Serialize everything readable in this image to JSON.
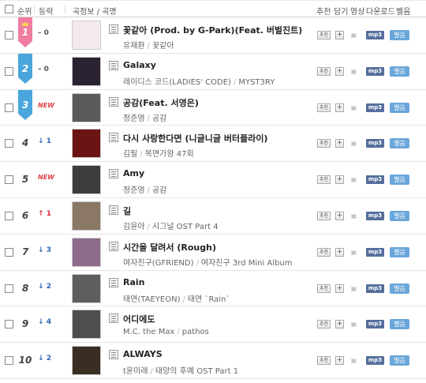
{
  "header": {
    "rank": "순위",
    "change": "등락",
    "song": "곡정보 / 곡명",
    "recommend": "추천",
    "add": "담기",
    "video": "영상",
    "download": "다운로드",
    "bell": "벨음"
  },
  "buttons": {
    "recommend": "추천",
    "add": "+",
    "mp3": "mp3",
    "bell": "벨음"
  },
  "colors": {
    "ribbon_pink": "#f07ca0",
    "ribbon_blue": "#4aa6dc",
    "up": "#d8293a",
    "down": "#2c65b2",
    "mp3": "#556f9c",
    "bell": "#69a6d9"
  },
  "rows": [
    {
      "rank": "1",
      "ribbon": "pink",
      "change": "0",
      "change_type": "same",
      "title": "꽃같아 (Prod. by G-Park)(Feat. 버벌진트)",
      "artist": "유재환",
      "album": "꽃같아",
      "cover": "#f3e9ee"
    },
    {
      "rank": "2",
      "ribbon": "blue",
      "change": "0",
      "change_type": "same",
      "title": "Galaxy",
      "artist": "레이디스 코드(LADIES' CODE)",
      "album": "MYST3RY",
      "cover": "#2a2230"
    },
    {
      "rank": "3",
      "ribbon": "blue",
      "change": "NEW",
      "change_type": "new",
      "title": "공감(Feat. 서영은)",
      "artist": "정준영",
      "album": "공감",
      "cover": "#5a5a5a"
    },
    {
      "rank": "4",
      "ribbon": "",
      "change": "1",
      "change_type": "down",
      "title": "다시 사랑한다면 (니글니글 버터플라이)",
      "artist": "김필",
      "album": "복면가왕 47회",
      "cover": "#6b1414"
    },
    {
      "rank": "5",
      "ribbon": "",
      "change": "NEW",
      "change_type": "new",
      "title": "Amy",
      "artist": "정준영",
      "album": "공감",
      "cover": "#3c3c3c"
    },
    {
      "rank": "6",
      "ribbon": "",
      "change": "1",
      "change_type": "up",
      "title": "길",
      "artist": "김윤아",
      "album": "시그널 OST Part 4",
      "cover": "#8a7766"
    },
    {
      "rank": "7",
      "ribbon": "",
      "change": "3",
      "change_type": "down",
      "title": "시간을 달려서 (Rough)",
      "artist": "여자친구(GFRIEND)",
      "album": "여자친구 3rd Mini Album",
      "cover": "#8e6b8a"
    },
    {
      "rank": "8",
      "ribbon": "",
      "change": "2",
      "change_type": "down",
      "title": "Rain",
      "artist": "태연(TAEYEON)",
      "album": "태연 `Rain`",
      "cover": "#5e5e5e"
    },
    {
      "rank": "9",
      "ribbon": "",
      "change": "4",
      "change_type": "down",
      "title": "어디에도",
      "artist": "M.C. the Max",
      "album": "pathos",
      "cover": "#4e4e4e"
    },
    {
      "rank": "10",
      "ribbon": "",
      "change": "2",
      "change_type": "down",
      "title": "ALWAYS",
      "artist": "t윤미래",
      "album": "태양의 후예 OST Part 1",
      "cover": "#3a2e22"
    }
  ]
}
